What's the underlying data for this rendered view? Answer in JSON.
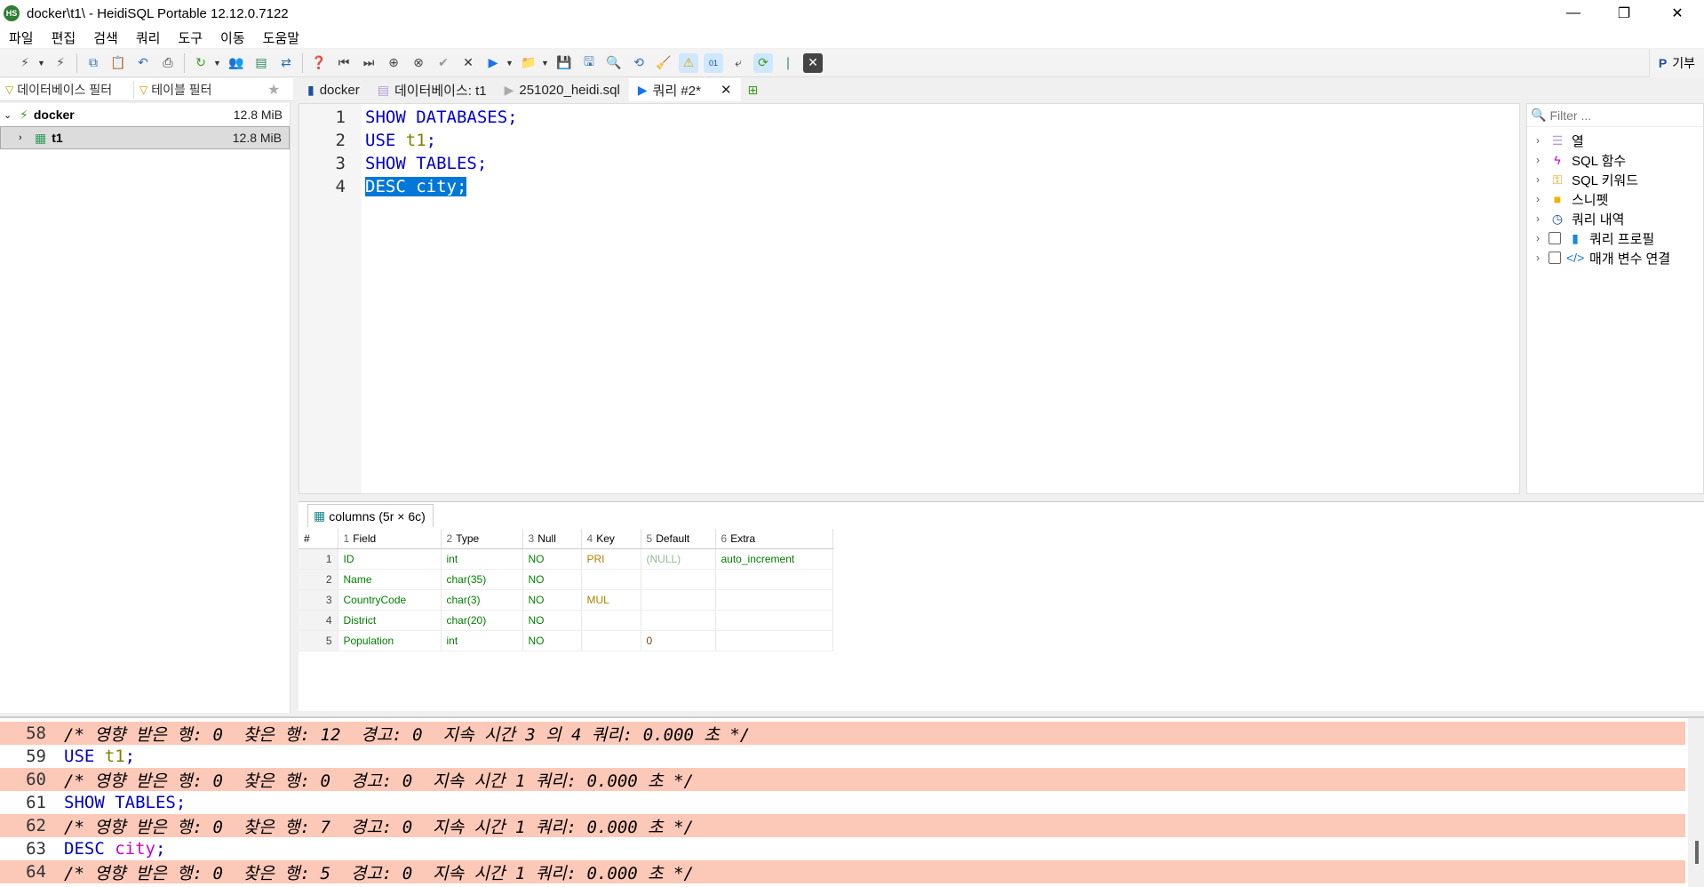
{
  "window": {
    "icon_text": "HS",
    "title": "docker\\t1\\ - HeidiSQL Portable 12.12.0.7122",
    "minimize": "—",
    "restore": "❐",
    "close": "✕"
  },
  "menu": [
    "파일",
    "편집",
    "검색",
    "쿼리",
    "도구",
    "이동",
    "도움말"
  ],
  "toolbar": {
    "donate_label": "기부"
  },
  "filters": {
    "database_filter": "데이터베이스 필터",
    "table_filter": "테이블 필터"
  },
  "tabs": [
    {
      "label": "docker"
    },
    {
      "label": "데이터베이스: t1"
    },
    {
      "label": "251020_heidi.sql"
    },
    {
      "label": "쿼리 #2*"
    }
  ],
  "tree": {
    "root": {
      "label": "docker",
      "size": "12.8 MiB"
    },
    "child": {
      "label": "t1",
      "size": "12.8 MiB"
    }
  },
  "editor": {
    "lines": [
      {
        "num": "1",
        "kw": "SHOW DATABASES;",
        "obj": ""
      },
      {
        "num": "2",
        "kw": "USE ",
        "obj": "t1",
        "tail": ";"
      },
      {
        "num": "3",
        "kw": "SHOW TABLES;",
        "obj": ""
      },
      {
        "num": "4",
        "kw": "DESC city;",
        "obj": ""
      }
    ]
  },
  "helpers": {
    "filter_placeholder": "Filter ...",
    "items": [
      "열",
      "SQL 함수",
      "SQL 키워드",
      "스니펫",
      "쿼리 내역",
      "쿼리 프로필",
      "매개 변수 연결"
    ]
  },
  "result": {
    "tab_label": "columns (5r × 6c)",
    "headers": [
      {
        "n": "#",
        "label": ""
      },
      {
        "n": "1",
        "label": "Field"
      },
      {
        "n": "2",
        "label": "Type"
      },
      {
        "n": "3",
        "label": "Null"
      },
      {
        "n": "4",
        "label": "Key"
      },
      {
        "n": "5",
        "label": "Default"
      },
      {
        "n": "6",
        "label": "Extra"
      }
    ],
    "rows": [
      [
        "1",
        "ID",
        "int",
        "NO",
        "PRI",
        "(NULL)",
        "auto_increment"
      ],
      [
        "2",
        "Name",
        "char(35)",
        "NO",
        "",
        "",
        ""
      ],
      [
        "3",
        "CountryCode",
        "char(3)",
        "NO",
        "MUL",
        "",
        ""
      ],
      [
        "4",
        "District",
        "char(20)",
        "NO",
        "",
        "",
        ""
      ],
      [
        "5",
        "Population",
        "int",
        "NO",
        "",
        "0",
        ""
      ]
    ]
  },
  "log": {
    "lines": [
      {
        "num": "58",
        "text": "/* 영향 받은 행: 0  찾은 행: 12  경고: 0  지속 시간 3 의 4 쿼리: 0.000 초 */"
      },
      {
        "num": "59",
        "kw": "USE ",
        "obj": "t1",
        "tail": ";"
      },
      {
        "num": "60",
        "text": "/* 영향 받은 행: 0  찾은 행: 0  경고: 0  지속 시간 1 쿼리: 0.000 초 */"
      },
      {
        "num": "61",
        "kw": "SHOW TABLES;"
      },
      {
        "num": "62",
        "text": "/* 영향 받은 행: 0  찾은 행: 7  경고: 0  지속 시간 1 쿼리: 0.000 초 */"
      },
      {
        "num": "63",
        "kw": "DESC ",
        "obj": "city",
        "tail": ";"
      },
      {
        "num": "64",
        "text": "/* 영향 받은 행: 0  찾은 행: 5  경고: 0  지속 시간 1 쿼리: 0.000 초 */"
      }
    ]
  }
}
